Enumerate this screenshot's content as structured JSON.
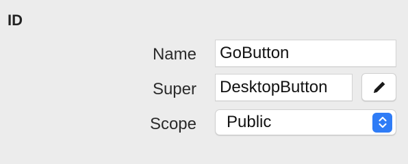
{
  "section": {
    "title": "ID"
  },
  "name_row": {
    "label": "Name",
    "value": "GoButton"
  },
  "super_row": {
    "label": "Super",
    "value": "DesktopButton",
    "edit_icon": "pencil-icon"
  },
  "scope_row": {
    "label": "Scope",
    "value": "Public",
    "stepper_icon": "chevron-up-down-icon"
  },
  "colors": {
    "background": "#ececec",
    "accent": "#2f7cf6",
    "field_bg": "#ffffff"
  }
}
